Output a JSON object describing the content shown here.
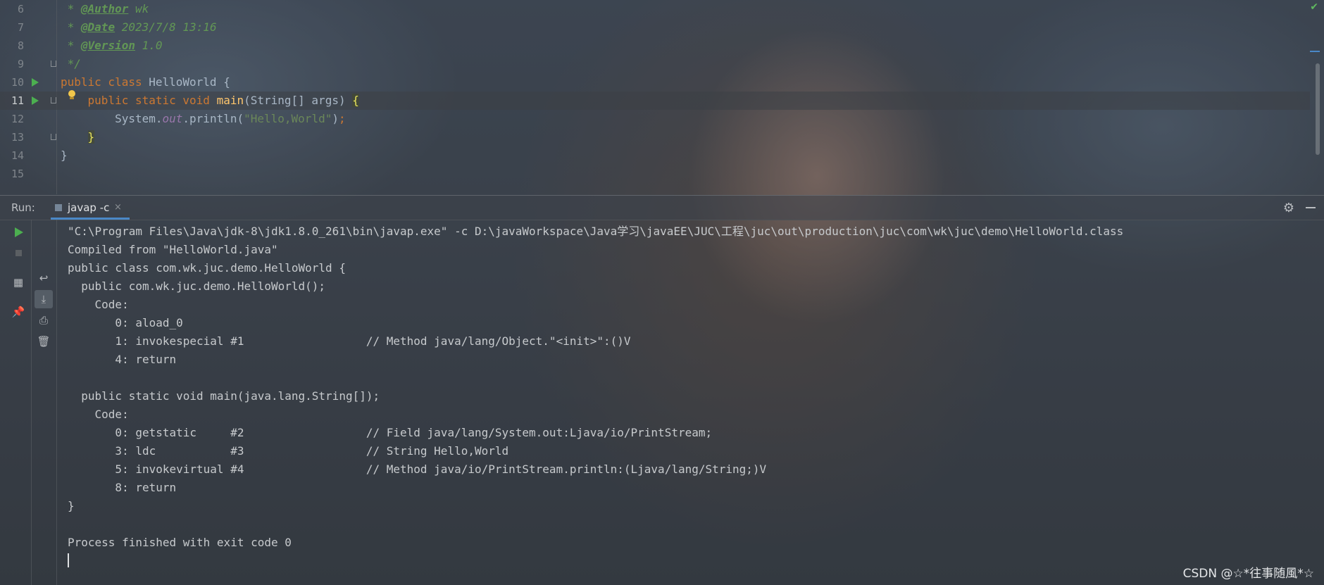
{
  "editor": {
    "lines": [
      {
        "num": "6",
        "parts": [
          {
            "c": "cmt",
            "t": " * "
          },
          {
            "c": "tag",
            "t": "@Author"
          },
          {
            "c": "cmt",
            "t": " wk"
          }
        ]
      },
      {
        "num": "7",
        "parts": [
          {
            "c": "cmt",
            "t": " * "
          },
          {
            "c": "tag",
            "t": "@Date"
          },
          {
            "c": "cmt",
            "t": " 2023/7/8 13:16"
          }
        ]
      },
      {
        "num": "8",
        "parts": [
          {
            "c": "cmt",
            "t": " * "
          },
          {
            "c": "tag",
            "t": "@Version"
          },
          {
            "c": "cmt",
            "t": " 1.0"
          }
        ]
      },
      {
        "num": "9",
        "parts": [
          {
            "c": "cmt",
            "t": " */"
          }
        ]
      },
      {
        "num": "10",
        "parts": [
          {
            "c": "kw",
            "t": "public class "
          },
          {
            "c": "",
            "t": "HelloWorld {"
          }
        ]
      },
      {
        "num": "11",
        "parts": [
          {
            "c": "",
            "t": "    "
          },
          {
            "c": "kw",
            "t": "public static void "
          },
          {
            "c": "fn",
            "t": "main"
          },
          {
            "c": "",
            "t": "(String[] args) "
          },
          {
            "c": "brace",
            "t": "{"
          }
        ]
      },
      {
        "num": "12",
        "parts": [
          {
            "c": "",
            "t": "        System."
          },
          {
            "c": "fld",
            "t": "out"
          },
          {
            "c": "",
            "t": ".println("
          },
          {
            "c": "str",
            "t": "\"Hello,World\""
          },
          {
            "c": "",
            "t": ")"
          },
          {
            "c": "kw",
            "t": ";"
          }
        ]
      },
      {
        "num": "13",
        "parts": [
          {
            "c": "",
            "t": "    "
          },
          {
            "c": "brace",
            "t": "}"
          }
        ]
      },
      {
        "num": "14",
        "parts": [
          {
            "c": "",
            "t": "}"
          }
        ]
      },
      {
        "num": "15",
        "parts": []
      }
    ],
    "current_line": "11"
  },
  "run_panel": {
    "label": "Run:",
    "tab_label": "javap -c",
    "tab_close": "×",
    "settings_icon": "gear-icon",
    "minimize_icon": "minimize-icon"
  },
  "console": {
    "lines": [
      "\"C:\\Program Files\\Java\\jdk-8\\jdk1.8.0_261\\bin\\javap.exe\" -c D:\\javaWorkspace\\Java学习\\javaEE\\JUC\\工程\\juc\\out\\production\\juc\\com\\wk\\juc\\demo\\HelloWorld.class",
      "Compiled from \"HelloWorld.java\"",
      "public class com.wk.juc.demo.HelloWorld {",
      "  public com.wk.juc.demo.HelloWorld();",
      "    Code:",
      "       0: aload_0",
      "       1: invokespecial #1                  // Method java/lang/Object.\"<init>\":()V",
      "       4: return",
      "",
      "  public static void main(java.lang.String[]);",
      "    Code:",
      "       0: getstatic     #2                  // Field java/lang/System.out:Ljava/io/PrintStream;",
      "       3: ldc           #3                  // String Hello,World",
      "       5: invokevirtual #4                  // Method java/io/PrintStream.println:(Ljava/lang/String;)V",
      "       8: return",
      "}",
      "",
      "Process finished with exit code 0"
    ]
  },
  "watermark": "CSDN @☆*往事随風*☆",
  "colors": {
    "keyword": "#cc7832",
    "comment": "#629755",
    "string": "#6a8759",
    "method": "#ffc66d",
    "run_green": "#4caf50",
    "tab_underline": "#4a88c7"
  }
}
